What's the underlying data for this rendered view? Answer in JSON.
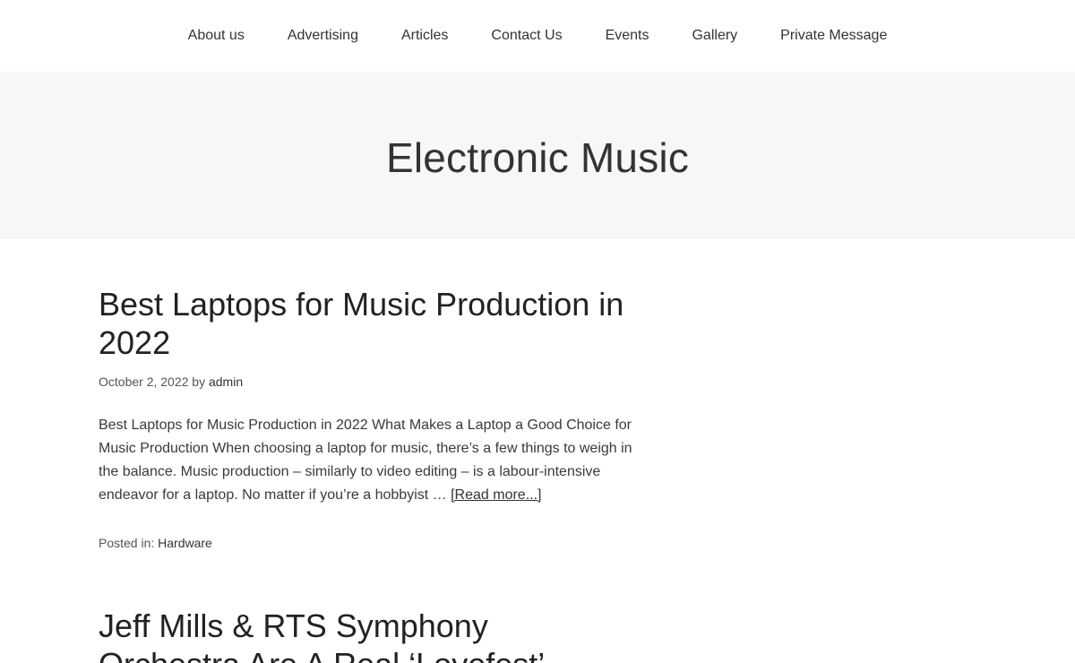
{
  "nav": {
    "items": [
      {
        "label": "About us"
      },
      {
        "label": "Advertising"
      },
      {
        "label": "Articles"
      },
      {
        "label": "Contact Us"
      },
      {
        "label": "Events"
      },
      {
        "label": "Gallery"
      },
      {
        "label": "Private Message"
      }
    ]
  },
  "archive": {
    "title": "Electronic Music"
  },
  "posts": [
    {
      "title": "Best Laptops for Music Production in 2022",
      "date": "October 2, 2022",
      "by": "by",
      "author": "admin",
      "excerpt": "Best Laptops for Music Production in 2022     What Makes a Laptop a Good Choice for Music Production   When choosing a laptop for music, there’s a few things to weigh in the balance. Music production – similarly to video editing – is a labour-intensive endeavor for a laptop. No matter if you’re a hobbyist …",
      "read_more": "[Read more...]",
      "posted_in_label": "Posted in:",
      "category": "Hardware"
    },
    {
      "title": "Jeff Mills & RTS Symphony Orchestra Are A Real ‘Lovefest’"
    }
  ]
}
